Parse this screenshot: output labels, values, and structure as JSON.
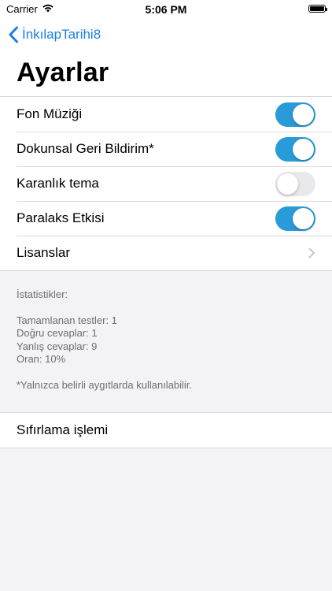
{
  "status_bar": {
    "carrier": "Carrier",
    "time": "5:06 PM"
  },
  "nav": {
    "back_label": "İnkılapTarihi8"
  },
  "title": "Ayarlar",
  "settings": [
    {
      "label": "Fon Müziği",
      "type": "toggle",
      "on": true
    },
    {
      "label": "Dokunsal Geri Bildirim*",
      "type": "toggle",
      "on": true
    },
    {
      "label": "Karanlık tema",
      "type": "toggle",
      "on": false
    },
    {
      "label": "Paralaks Etkisi",
      "type": "toggle",
      "on": true
    },
    {
      "label": "Lisanslar",
      "type": "disclosure"
    }
  ],
  "stats": {
    "header": "İstatistikler:",
    "completed": "Tamamlanan testler: 1",
    "correct": "Doğru cevaplar: 1",
    "wrong": "Yanlış cevaplar: 9",
    "ratio": "Oran: 10%",
    "note": "*Yalnızca belirli aygıtlarda kullanılabilir."
  },
  "reset": {
    "label": "Sıfırlama işlemi"
  },
  "colors": {
    "accent": "#1a7fe8",
    "toggle_on": "#2a9bd9",
    "background": "#f2f2f7"
  }
}
